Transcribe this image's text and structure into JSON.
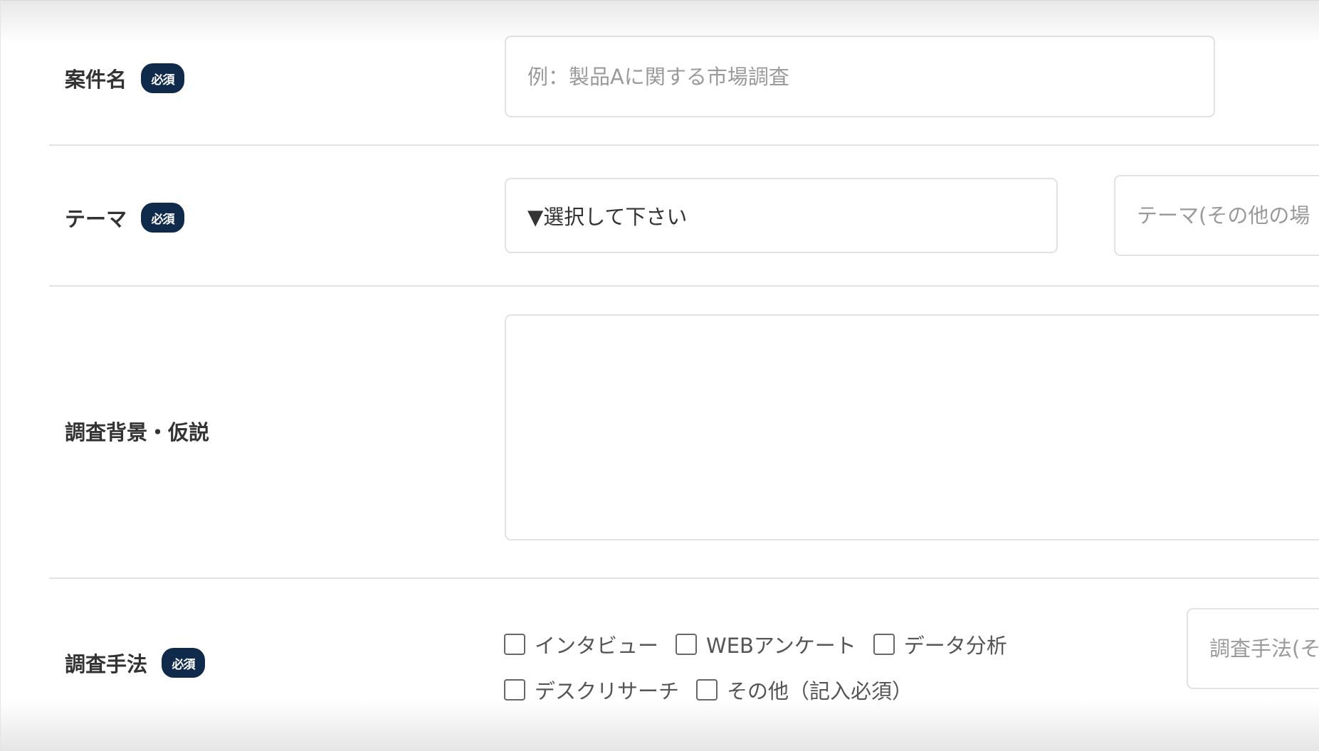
{
  "form": {
    "project_name": {
      "label": "案件名",
      "badge": "必須",
      "placeholder": "例：製品Aに関する市場調査"
    },
    "theme": {
      "label": "テーマ",
      "badge": "必須",
      "select_value": "▼選択して下さい",
      "other_placeholder": "テーマ(その他の場"
    },
    "background": {
      "label": "調査背景・仮説",
      "value": ""
    },
    "method": {
      "label": "調査手法",
      "badge": "必須",
      "options": [
        {
          "label": "インタビュー",
          "checked": false
        },
        {
          "label": "WEBアンケート",
          "checked": false
        },
        {
          "label": "データ分析",
          "checked": false
        },
        {
          "label": "デスクリサーチ",
          "checked": false
        },
        {
          "label": "その他（記入必須）",
          "checked": false
        }
      ],
      "other_placeholder": "調査手法(そ"
    }
  },
  "colors": {
    "badge_bg": "#102a4c",
    "border": "#e2e2e2",
    "placeholder": "#9a9a9a"
  }
}
